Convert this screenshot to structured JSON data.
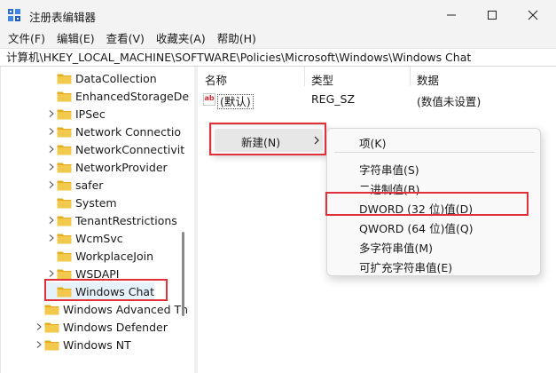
{
  "window": {
    "title": "注册表编辑器"
  },
  "menu": [
    "文件(F)",
    "编辑(E)",
    "查看(V)",
    "收藏夹(A)",
    "帮助(H)"
  ],
  "address": "计算机\\HKEY_LOCAL_MACHINE\\SOFTWARE\\Policies\\Microsoft\\Windows\\Windows Chat",
  "tree": [
    {
      "label": "DataCollection",
      "expandable": false
    },
    {
      "label": "EnhancedStorageDe",
      "expandable": false
    },
    {
      "label": "IPSec",
      "expandable": true
    },
    {
      "label": "Network Connectio",
      "expandable": true
    },
    {
      "label": "NetworkConnectivit",
      "expandable": true
    },
    {
      "label": "NetworkProvider",
      "expandable": true
    },
    {
      "label": "safer",
      "expandable": true
    },
    {
      "label": "System",
      "expandable": false
    },
    {
      "label": "TenantRestrictions",
      "expandable": true
    },
    {
      "label": "WcmSvc",
      "expandable": true
    },
    {
      "label": "WorkplaceJoin",
      "expandable": false
    },
    {
      "label": "WSDAPI",
      "expandable": true
    },
    {
      "label": "Windows Chat",
      "expandable": false,
      "selected": true
    },
    {
      "label": "Windows Advanced Th",
      "expandable": false,
      "level": "parent"
    },
    {
      "label": "Windows Defender",
      "expandable": true,
      "level": "parent"
    },
    {
      "label": "Windows NT",
      "expandable": true,
      "level": "parent"
    }
  ],
  "columns": {
    "name": "名称",
    "type": "类型",
    "data": "数据"
  },
  "values": [
    {
      "icon": "ab",
      "name": "(默认)",
      "type": "REG_SZ",
      "data": "(数值未设置)"
    }
  ],
  "context_menu": {
    "new_label": "新建(N)"
  },
  "submenu": {
    "key": "项(K)",
    "items": [
      "字符串值(S)",
      "二进制值(B)",
      "DWORD (32 位)值(D)",
      "QWORD (64 位)值(Q)",
      "多字符串值(M)",
      "可扩充字符串值(E)"
    ]
  },
  "colors": {
    "highlight": "#e0303a",
    "folder": "#f2c94c",
    "folder_dark": "#e3ac1b"
  }
}
